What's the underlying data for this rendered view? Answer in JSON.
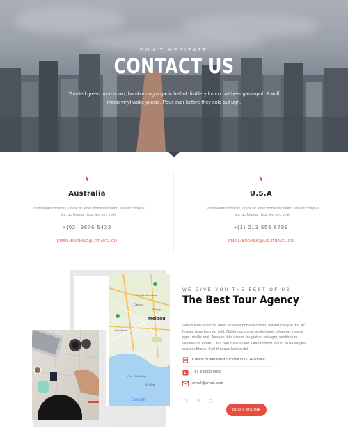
{
  "hero": {
    "kicker": "DON'T HESITATE",
    "title": "CONTACT US",
    "text": "Tousled green juice squid, humblebrag organic hell of distillery lomo craft beer gastropub 3 wolf moon vinyl woke yuccie. Pour-over before they sold out ugh."
  },
  "offices": [
    {
      "name": "Australia",
      "description": "Vestibulum rhoncus, dolor sit amet porta tincidunt, elit est congue dui, ac feugiat risus leo nec velit.",
      "phone": "+(02) 9876 5432",
      "email": "EMAIL: BOOKING@-JTRAVEL.CO"
    },
    {
      "name": "U.S.A",
      "description": "Vestibulum rhoncus, dolor sit amet porta tincidunt, elit est congue dui, ac feugiat risus leo nec velit.",
      "phone": "+(1) 213 555 6789",
      "email": "EMAIL: BOOKING@US-JTRAVEL.CO"
    }
  ],
  "map": {
    "labels": [
      "North Melbourne",
      "Carlton",
      "Fitzroy",
      "Melbou",
      "Docklands",
      "St Kilda",
      "Port Phillip Bay"
    ],
    "attribution": "Google"
  },
  "agency": {
    "kicker": "WE GIVE YOU THE BEST OF US",
    "title": "The Best Tour Agency",
    "description": "Vestibulum rhoncus, dolor sit amet porta tincidunt, elit est congue dui, ac feugiat risus leo nec velit. Nullam ac purus scelerisque, placerat massa eget, mollis erat. Aenean felis ipsum, feugiat ac est eget, vestibulum vestibulum lorem. Cras non cursus velit, vitae tempor lacus. Nulla sagittis auctor ultrices. Sed rhoncus lacinia dui.",
    "address": "Collins Street West Victoria 8007 Australia",
    "phone": "+61 3 0000 0000",
    "email": "email@email.com",
    "button": "BOOK ONLINE"
  },
  "icons": [
    "location-icon",
    "phone-icon",
    "mail-icon",
    "twitter-icon",
    "pinterest-icon",
    "instagram-icon"
  ],
  "colors": {
    "accent": "#e74c3c",
    "text": "#222222",
    "muted": "#888888"
  }
}
